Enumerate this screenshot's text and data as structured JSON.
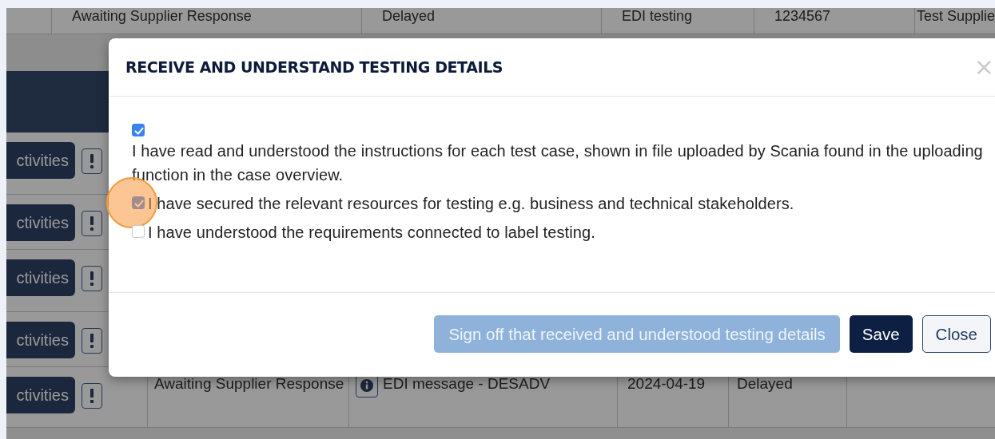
{
  "background_table": {
    "top_row": [
      "Awaiting Supplier Response",
      "Delayed",
      "EDI testing",
      "1234567",
      "Test Supplie"
    ],
    "rows": [
      {
        "button": "ctivities"
      },
      {
        "button": "ctivities"
      },
      {
        "button": "ctivities"
      },
      {
        "button": "ctivities"
      },
      {
        "button": "ctivities",
        "status": "Awaiting Supplier Response",
        "message": "EDI message - DESADV",
        "date": "2024-04-19",
        "state": "Delayed"
      }
    ]
  },
  "modal": {
    "title": "RECEIVE AND UNDERSTAND TESTING DETAILS",
    "close": "×",
    "checkboxes": [
      {
        "label": "I have read and understood the instructions for each test case, shown in file uploaded by Scania found in the uploading function in the case overview.",
        "checked": true,
        "highlighted": false
      },
      {
        "label": "I have secured the relevant resources for testing e.g. business and technical stakeholders.",
        "checked": true,
        "highlighted": true
      },
      {
        "label": "I have understood the requirements connected to label testing.",
        "checked": false,
        "highlighted": false
      }
    ],
    "buttons": [
      {
        "label": "Sign off that received and understood testing details",
        "kind": "disabled"
      },
      {
        "label": "Save",
        "kind": "primary"
      },
      {
        "label": "Close",
        "kind": "secondary"
      }
    ]
  }
}
